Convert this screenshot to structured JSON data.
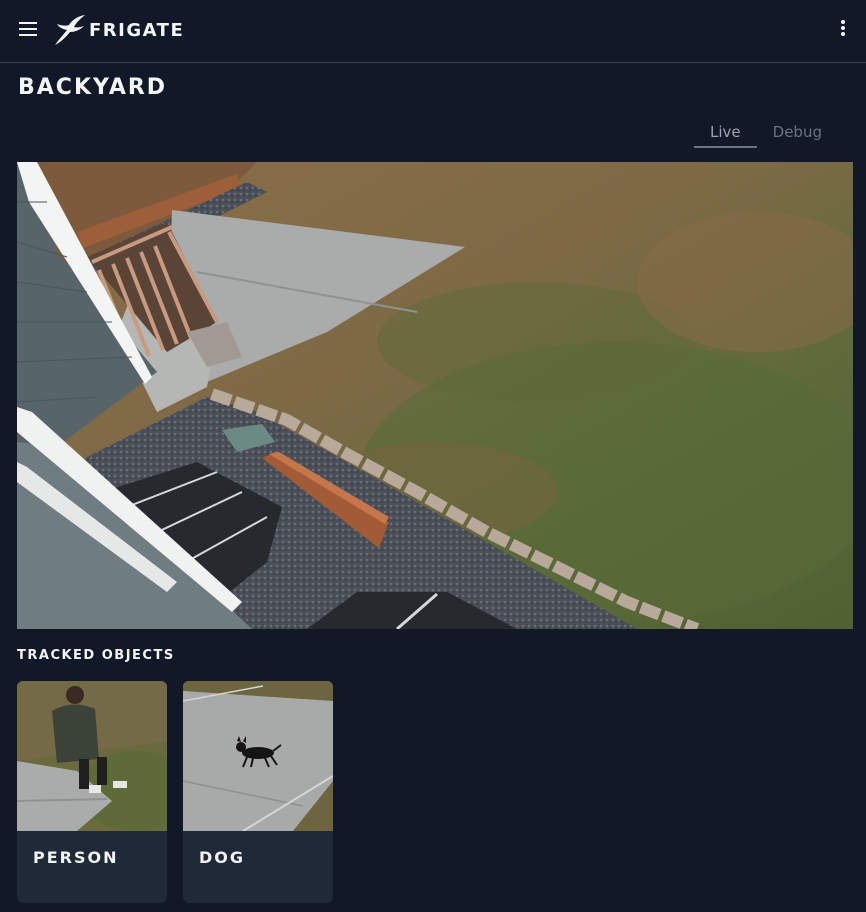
{
  "app": {
    "brand": "FRIGATE"
  },
  "icons": {
    "menu": "hamburger-menu-icon",
    "logo": "frigate-bird-logo",
    "more": "kebab-menu-icon"
  },
  "page": {
    "title": "BACKYARD"
  },
  "tabs": [
    {
      "label": "Live",
      "active": true
    },
    {
      "label": "Debug",
      "active": false
    }
  ],
  "tracked": {
    "heading": "TRACKED OBJECTS",
    "items": [
      {
        "label": "PERSON"
      },
      {
        "label": "DOG"
      }
    ]
  },
  "colors": {
    "background": "#111827",
    "card": "#1f2937",
    "text": "#f3f4f6",
    "muted": "#6b7280"
  }
}
